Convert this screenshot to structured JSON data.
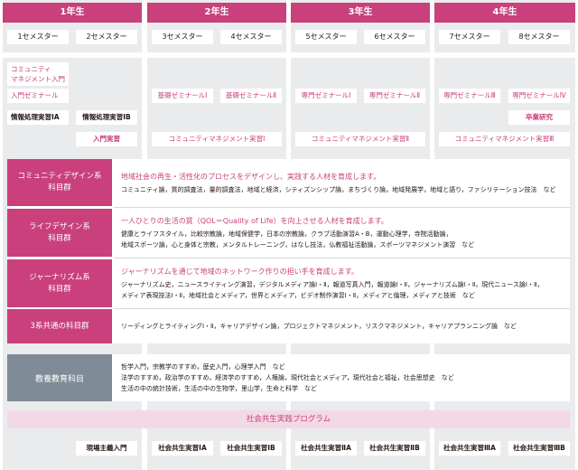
{
  "years": [
    {
      "label": "1年生",
      "sems": [
        "1セメスター",
        "2セメスター"
      ]
    },
    {
      "label": "2年生",
      "sems": [
        "3セメスター",
        "4セメスター"
      ]
    },
    {
      "label": "3年生",
      "sems": [
        "5セメスター",
        "6セメスター"
      ]
    },
    {
      "label": "4年生",
      "sems": [
        "7セメスター",
        "8セメスター"
      ]
    }
  ],
  "courses": {
    "community_intro": "コミュニティ\nマネジメント入門",
    "intro_seminar": "入門ゼミナール",
    "info_1a": "情報処理実習ⅠA",
    "info_1b": "情報処理実習ⅠB",
    "intro_practice": "入門実習",
    "basic_seminar_1": "基礎ゼミナールⅠ",
    "basic_seminar_2": "基礎ゼミナールⅡ",
    "cm_practice_1": "コミュニティマネジメント実習Ⅰ",
    "adv_seminar_1": "専門ゼミナールⅠ",
    "adv_seminar_2": "専門ゼミナールⅡ",
    "cm_practice_2": "コミュニティマネジメント実習Ⅱ",
    "adv_seminar_3": "専門ゼミナールⅢ",
    "adv_seminar_4": "専門ゼミナールⅣ",
    "thesis": "卒業研究",
    "cm_practice_3": "コミュニティマネジメント実習Ⅲ"
  },
  "groups": [
    {
      "name": "コミュニティデザイン系\n科目群",
      "title": "地域社会の再生・活性化のプロセスをデザインし、実践する人材を育成します。",
      "courses": "コミュニティ論，質的調査法，量的調査法，地域と経済，シティズンシップ論，まちづくり論，地域発展学，地域と語り，ファシリテーション技法　など"
    },
    {
      "name": "ライフデザイン系\n科目群",
      "title": "一人ひとりの生活の質（QOL＝Quality of Life）を向上させる人材を育成します。",
      "courses": "健康とライフスタイル，比較宗教論，地域保健学，日本の宗教論，クラブ活動演習A・B，運動心理学，寺院活動論，\n地域スポーツ論，心と身体と宗教，メンタルトレーニング，はなし技法，仏教福祉活動論，スポーツマネジメント演習　など"
    },
    {
      "name": "ジャーナリズム系\n科目群",
      "title": "ジャーナリズムを通じて地域のネットワーク作りの担い手を育成します。",
      "courses": "ジャーナリズム史，ニュースライティング演習，デジタルメディア論Ⅰ・Ⅱ，報道写真入門，報道論Ⅰ・Ⅱ，ジャーナリズム論Ⅰ・Ⅱ，現代ニュース論Ⅰ・Ⅱ，\nメディア表現技法Ⅰ・Ⅱ，地域社会とメディア，世界とメディア，ビデオ制作演習Ⅰ・Ⅱ，メディアと倫理，メディアと技術　など"
    },
    {
      "name": "3系共通の科目群",
      "title": "",
      "courses": "リーディングとライティングⅠ・Ⅱ，キャリアデザイン論，プロジェクトマネジメント，リスクマネジメント，キャリアプランニング論　など"
    }
  ],
  "liberal": {
    "name": "教養教育科目",
    "courses": "哲学入門，宗教学のすすめ，歴史入門，心理学入門　など\n法学のすすめ，政治学のすすめ，経済学のすすめ，人権論，現代社会とメディア，現代社会と福祉，社会思想史　など\n生活の中の統計技術，生活の中の生物学，里山学，生命と科学　など"
  },
  "program": {
    "title": "社会共生実践プログラム",
    "items": [
      "現場主義入門",
      "社会共生実習ⅠA",
      "社会共生実習ⅠB",
      "社会共生実習ⅡA",
      "社会共生実習ⅡB",
      "社会共生実習ⅢA",
      "社会共生実習ⅢB"
    ]
  },
  "colors": {
    "accent": "#c9407c",
    "grey_band": "#7f8b96",
    "program_band": "#f3d9e5",
    "column_bg": "#eaebec"
  }
}
